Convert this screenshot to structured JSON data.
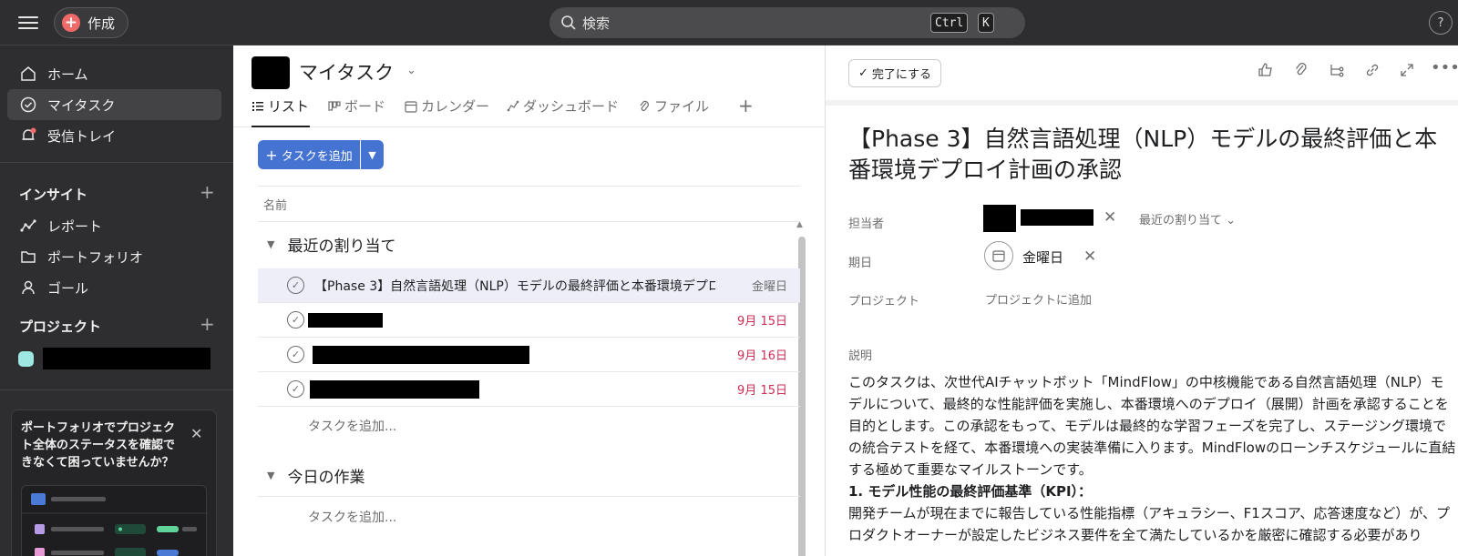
{
  "topbar": {
    "create_label": "作成",
    "search_placeholder": "検索",
    "shortcut_keys": [
      "Ctrl",
      "K"
    ],
    "help_label": "?"
  },
  "sidebar": {
    "nav": [
      {
        "label": "ホーム",
        "icon": "home-icon"
      },
      {
        "label": "マイタスク",
        "icon": "check-circle-icon",
        "active": true
      },
      {
        "label": "受信トレイ",
        "icon": "bell-icon"
      }
    ],
    "insights_heading": "インサイト",
    "insights": [
      {
        "label": "レポート",
        "icon": "chart-line-icon"
      },
      {
        "label": "ポートフォリオ",
        "icon": "folder-icon"
      },
      {
        "label": "ゴール",
        "icon": "person-icon"
      }
    ],
    "projects_heading": "プロジェクト",
    "project_color": "#9ee7e3",
    "promo_text": "ポートフォリオでプロジェクト全体のステータスを確認できなくて困っていませんか？"
  },
  "main": {
    "title": "マイタスク",
    "tabs": [
      {
        "label": "リスト",
        "icon": "list-icon",
        "active": true
      },
      {
        "label": "ボード",
        "icon": "board-icon"
      },
      {
        "label": "カレンダー",
        "icon": "calendar-icon"
      },
      {
        "label": "ダッシュボード",
        "icon": "dashboard-icon"
      },
      {
        "label": "ファイル",
        "icon": "paperclip-icon"
      }
    ],
    "add_task_label": "タスクを追加",
    "column_name": "名前",
    "sections": [
      {
        "title": "最近の割り当て",
        "tasks": [
          {
            "title": "【Phase 3】自然言語処理（NLP）モデルの最終評価と本番環境デプロイ計画の承認",
            "due": "金曜日",
            "due_color": "#6d6e6f"
          },
          {
            "title": "",
            "due": "9月 15日",
            "due_color": "#c92f54"
          },
          {
            "title": "",
            "due": "9月 16日",
            "due_color": "#c92f54"
          },
          {
            "title": "",
            "due": "9月 15日",
            "due_color": "#c92f54"
          }
        ],
        "add_task": "タスクを追加..."
      },
      {
        "title": "今日の作業",
        "tasks": [],
        "add_task": "タスクを追加..."
      }
    ]
  },
  "detail": {
    "complete_label": "完了にする",
    "title": "【Phase 3】自然言語処理（NLP）モデルの最終評価と本番環境デプロイ計画の承認",
    "labels": {
      "assignee": "担当者",
      "due": "期日",
      "project": "プロジェクト",
      "description": "説明"
    },
    "assignee_section": "最近の割り当て",
    "due_value": "金曜日",
    "project_add": "プロジェクトに追加",
    "description": [
      "このタスクは、次世代AIチャットボット「MindFlow」の中核機能である自然言語処理（NLP）モデルについて、最終的な性能評価を実施し、本番環境へのデプロイ（展開）計画を承認することを目的とします。この承認をもって、モデルは最終的な学習フェーズを完了し、ステージング環境での統合テストを経て、本番環境への実装準備に入ります。MindFlowのローンチスケジュールに直結する極めて重要なマイルストーンです。",
      "1. モデル性能の最終評価基準（KPI）：",
      "開発チームが現在までに報告している性能指標（アキュラシー、F1スコア、応答速度など）が、プロダクトオーナーが設定したビジネス要件を全て満たしているかを厳密に確認する必要があり"
    ]
  }
}
